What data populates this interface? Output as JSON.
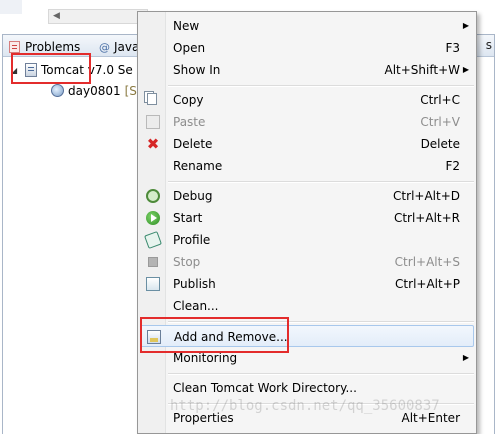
{
  "views": {
    "tabs": [
      {
        "label": "Problems",
        "icon": "problems-icon"
      },
      {
        "label": "Java",
        "icon": "at-icon"
      }
    ],
    "overflow_label": "s",
    "tree": {
      "server": {
        "label": "Tomcat v7.0 Se",
        "icon": "server-icon"
      },
      "module": {
        "label": "day0801",
        "status": "[S",
        "icon": "web-module-icon"
      }
    }
  },
  "context_menu": {
    "items": [
      {
        "label": "New",
        "shortcut": "",
        "submenu": true
      },
      {
        "label": "Open",
        "shortcut": "F3"
      },
      {
        "label": "Show In",
        "shortcut": "Alt+Shift+W",
        "submenu": true
      },
      {
        "label": "Copy",
        "shortcut": "Ctrl+C",
        "icon": "copy-icon"
      },
      {
        "label": "Paste",
        "shortcut": "Ctrl+V",
        "icon": "paste-icon",
        "disabled": true
      },
      {
        "label": "Delete",
        "shortcut": "Delete",
        "icon": "delete-icon"
      },
      {
        "label": "Rename",
        "shortcut": "F2"
      },
      {
        "label": "Debug",
        "shortcut": "Ctrl+Alt+D",
        "icon": "debug-icon"
      },
      {
        "label": "Start",
        "shortcut": "Ctrl+Alt+R",
        "icon": "start-icon"
      },
      {
        "label": "Profile",
        "shortcut": "",
        "icon": "profile-icon"
      },
      {
        "label": "Stop",
        "shortcut": "Ctrl+Alt+S",
        "icon": "stop-icon",
        "disabled": true
      },
      {
        "label": "Publish",
        "shortcut": "Ctrl+Alt+P",
        "icon": "publish-icon"
      },
      {
        "label": "Clean...",
        "shortcut": ""
      },
      {
        "label": "Add and Remove...",
        "shortcut": "",
        "icon": "add-remove-icon",
        "highlighted": true
      },
      {
        "label": "Monitoring",
        "shortcut": "",
        "submenu": true
      },
      {
        "label": "Clean Tomcat Work Directory...",
        "shortcut": ""
      },
      {
        "label": "Properties",
        "shortcut": "Alt+Enter"
      }
    ]
  },
  "watermark": "http://blog.csdn.net/qq_35600837",
  "colors": {
    "highlight_box": "#e32c2c",
    "menu_bg": "#f5f5f5",
    "hover_bg": "#e3edf9"
  }
}
